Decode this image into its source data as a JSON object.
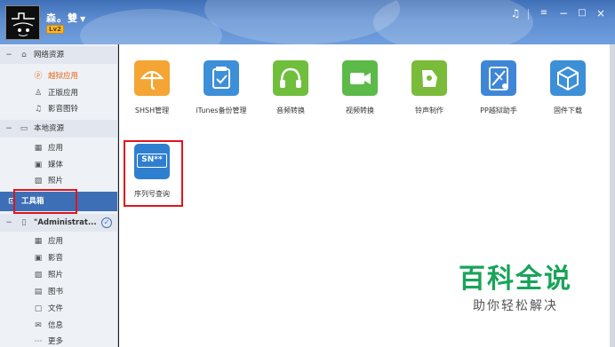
{
  "header": {
    "username": "森。雙",
    "level_badge": "Lv2",
    "window_buttons": [
      "music-note-icon",
      "menu-icon",
      "minimize-icon",
      "maximize-icon",
      "close-icon"
    ]
  },
  "sidebar": {
    "network": {
      "label": "网络资源",
      "items": [
        "越狱应用",
        "正版应用",
        "影音图铃"
      ]
    },
    "local": {
      "label": "本地资源",
      "items": [
        "应用",
        "媒体",
        "照片"
      ]
    },
    "toolbox": {
      "label": "工具箱"
    },
    "device": {
      "label": "\"Administrat...",
      "items": [
        "应用",
        "影音",
        "照片",
        "图书",
        "文件",
        "信息",
        "更多"
      ]
    }
  },
  "tools": [
    {
      "label": "SHSH管理",
      "color": "#f4a533",
      "icon": "umbrella-icon"
    },
    {
      "label": "iTunes备份管理",
      "color": "#3d8fd8",
      "icon": "backup-icon"
    },
    {
      "label": "音频转换",
      "color": "#6fbe3c",
      "icon": "headphones-icon"
    },
    {
      "label": "视频转换",
      "color": "#5cba48",
      "icon": "video-camera-icon"
    },
    {
      "label": "铃声制作",
      "color": "#7abb3a",
      "icon": "bell-icon"
    },
    {
      "label": "PP越狱助手",
      "color": "#3f87d6",
      "icon": "jailbreak-icon"
    },
    {
      "label": "固件下载",
      "color": "#3d8fd8",
      "icon": "cube-icon"
    },
    {
      "label": "序列号查询",
      "color": "#2f7fd1",
      "icon": "serial-number-icon",
      "tile_text": "SN**"
    }
  ],
  "watermark": {
    "title": "百科全说",
    "subtitle": "助你轻松解决"
  },
  "colors": {
    "accent": "#3d6fb6",
    "highlight_border": "#e0141b",
    "active_orange": "#e8661c",
    "watermark_green": "#19a35a"
  }
}
